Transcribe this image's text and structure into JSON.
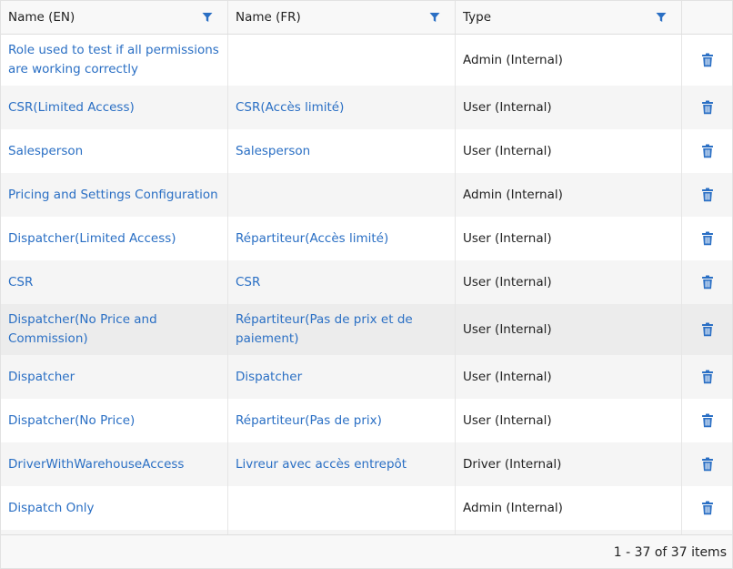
{
  "header": {
    "col_name_en": "Name (EN)",
    "col_name_fr": "Name (FR)",
    "col_type": "Type"
  },
  "colors": {
    "link": "#2a6fc4",
    "filter_icon": "#2a6fc4",
    "alt_row": "#f5f5f5"
  },
  "rows": [
    {
      "name_en": "Role used to test if all permissions are working correctly",
      "name_fr": "",
      "type": "Admin (Internal)"
    },
    {
      "name_en": "CSR(Limited Access)",
      "name_fr": "CSR(Accès limité)",
      "type": "User (Internal)"
    },
    {
      "name_en": "Salesperson",
      "name_fr": "Salesperson",
      "type": "User (Internal)"
    },
    {
      "name_en": "Pricing and Settings Configuration",
      "name_fr": "",
      "type": "Admin (Internal)"
    },
    {
      "name_en": "Dispatcher(Limited Access)",
      "name_fr": "Répartiteur(Accès limité)",
      "type": "User (Internal)"
    },
    {
      "name_en": "CSR",
      "name_fr": "CSR",
      "type": "User (Internal)"
    },
    {
      "name_en": "Dispatcher(No Price and Commission)",
      "name_fr": "Répartiteur(Pas de prix et de paiement)",
      "type": "User (Internal)"
    },
    {
      "name_en": "Dispatcher",
      "name_fr": "Dispatcher",
      "type": "User (Internal)"
    },
    {
      "name_en": "Dispatcher(No Price)",
      "name_fr": "Répartiteur(Pas de prix)",
      "type": "User (Internal)"
    },
    {
      "name_en": "DriverWithWarehouseAccess",
      "name_fr": "Livreur avec accès entrepôt",
      "type": "Driver (Internal)"
    },
    {
      "name_en": "Dispatch Only",
      "name_fr": "",
      "type": "Admin (Internal)"
    },
    {
      "name_en": "",
      "name_fr": "",
      "type": ""
    }
  ],
  "row_icon": "trash-icon",
  "footer": {
    "pager_text": "1 - 37 of 37 items"
  }
}
